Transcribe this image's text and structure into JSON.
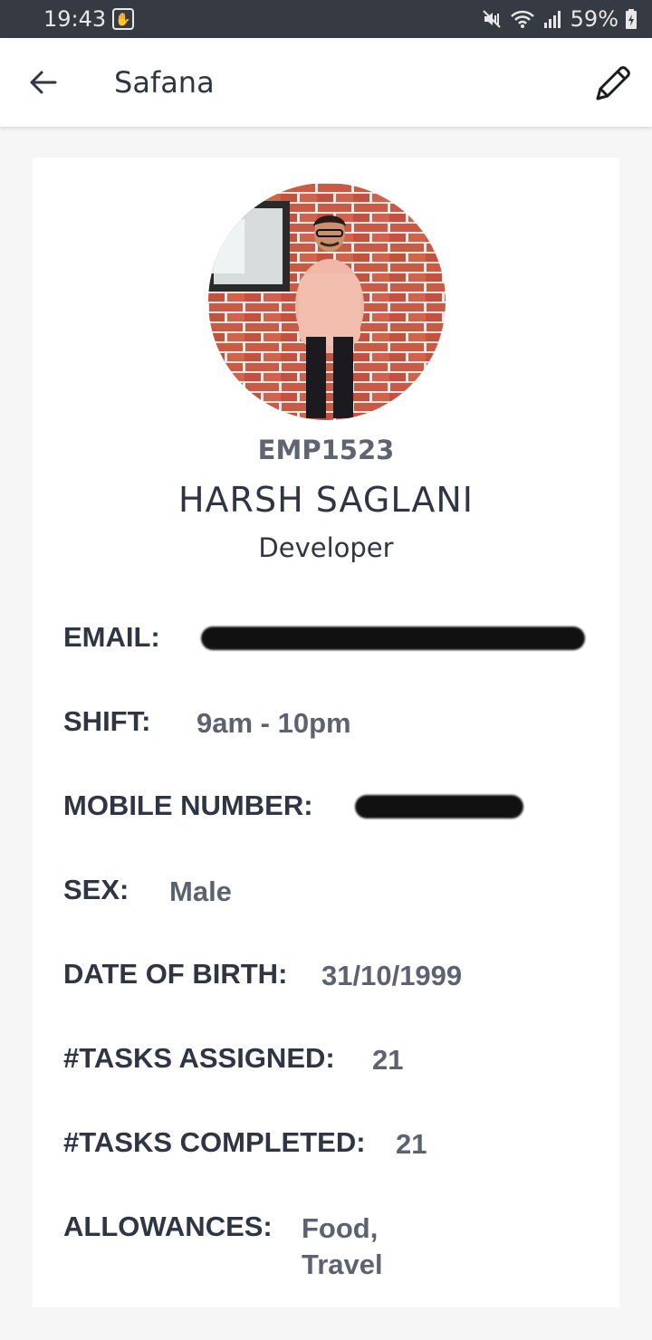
{
  "status_bar": {
    "time": "19:43",
    "battery": "59%"
  },
  "header": {
    "title": "Safana"
  },
  "profile": {
    "employee_id": "EMP1523",
    "name": "HARSH SAGLANI",
    "role": "Developer"
  },
  "fields": {
    "email": {
      "label": "EMAIL:",
      "value": ""
    },
    "shift": {
      "label": "SHIFT:",
      "value": "9am - 10pm"
    },
    "mobile": {
      "label": "MOBILE NUMBER:",
      "value": ""
    },
    "sex": {
      "label": "SEX:",
      "value": "Male"
    },
    "dob": {
      "label": "DATE OF BIRTH:",
      "value": "31/10/1999"
    },
    "tasks_assigned": {
      "label": "#TASKS ASSIGNED:",
      "value": "21"
    },
    "tasks_completed": {
      "label": "#TASKS COMPLETED:",
      "value": "21"
    },
    "allowances": {
      "label": "ALLOWANCES:",
      "value_line1": "Food,",
      "value_line2": "Travel"
    }
  },
  "colors": {
    "status_bar": "#363a43",
    "label": "#2f3542",
    "value": "#5d6270",
    "background": "#f6f6f7"
  }
}
